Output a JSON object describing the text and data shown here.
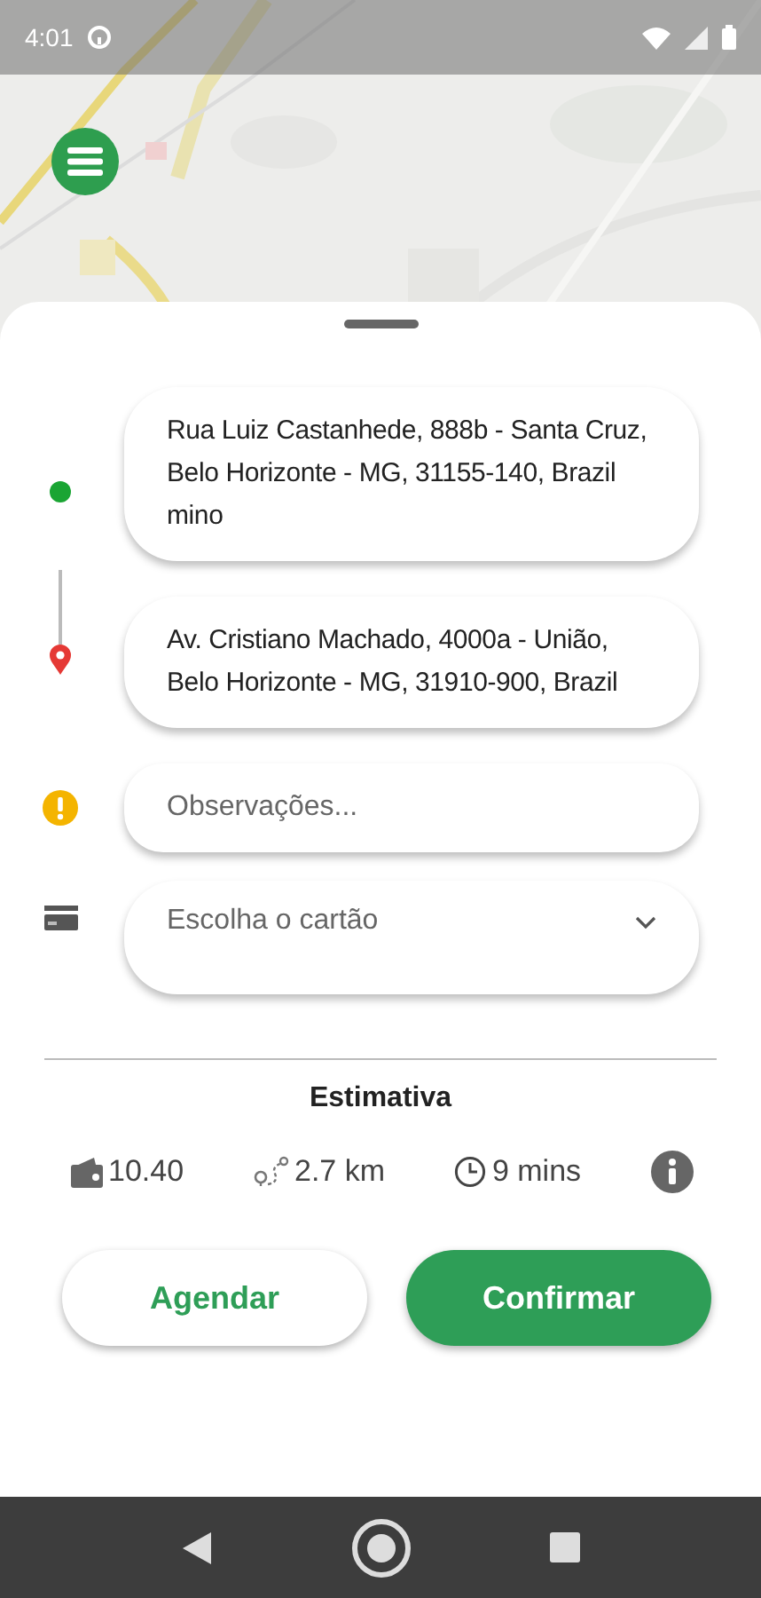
{
  "status_bar": {
    "time": "4:01"
  },
  "route": {
    "origin": "Rua Luiz Castanhede, 888b - Santa Cruz, Belo Horizonte - MG, 31155-140, Brazil mino",
    "destination": "Av. Cristiano Machado, 4000a - União, Belo Horizonte - MG, 31910-900, Brazil"
  },
  "notes": {
    "placeholder": "Observações..."
  },
  "card_select": {
    "placeholder": "Escolha o cartão"
  },
  "estimate": {
    "title": "Estimativa",
    "price": "10.40",
    "distance": "2.7 km",
    "duration": "9 mins"
  },
  "buttons": [
    {
      "label": "Agendar",
      "kind": "secondary"
    },
    {
      "label": "Confirmar",
      "kind": "primary"
    }
  ]
}
